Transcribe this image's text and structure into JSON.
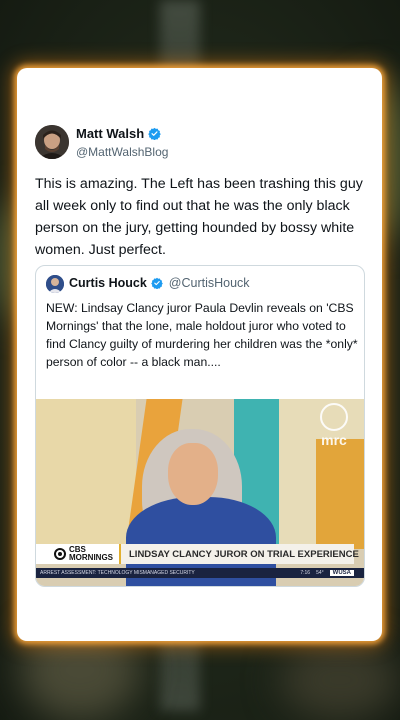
{
  "tweet": {
    "author_name": "Matt Walsh",
    "author_handle": "@MattWalshBlog",
    "text": "This is amazing. The Left has been trashing this guy all week only to find out that he was the only black person on the jury, getting hounded by bossy white women. Just perfect."
  },
  "quoted_tweet": {
    "author_name": "Curtis Houck",
    "author_handle": "@CurtisHouck",
    "text": "NEW: Lindsay Clancy juror Paula Devlin reveals on 'CBS Mornings' that the lone, male holdout juror who voted to find Clancy guilty of murdering her children was the *only* person of color -- a black man...."
  },
  "video": {
    "watermark": "mrc",
    "show_brand_line1": "CBS",
    "show_brand_line2": "MORNINGS",
    "headline": "LINDSAY CLANCY JUROR ON TRIAL EXPERIENCE",
    "ticker": "ARREST ASSESSMENT: TECHNOLOGY MISMANAGED SECURITY",
    "ticker_time": "7:16",
    "ticker_temp": "54°",
    "ticker_station": "WUSA"
  },
  "colors": {
    "verified_badge": "#1d9bf0",
    "card_glow": "#ffaa3c",
    "handle_gray": "#536471"
  },
  "icons": [
    "verified-badge-icon"
  ]
}
